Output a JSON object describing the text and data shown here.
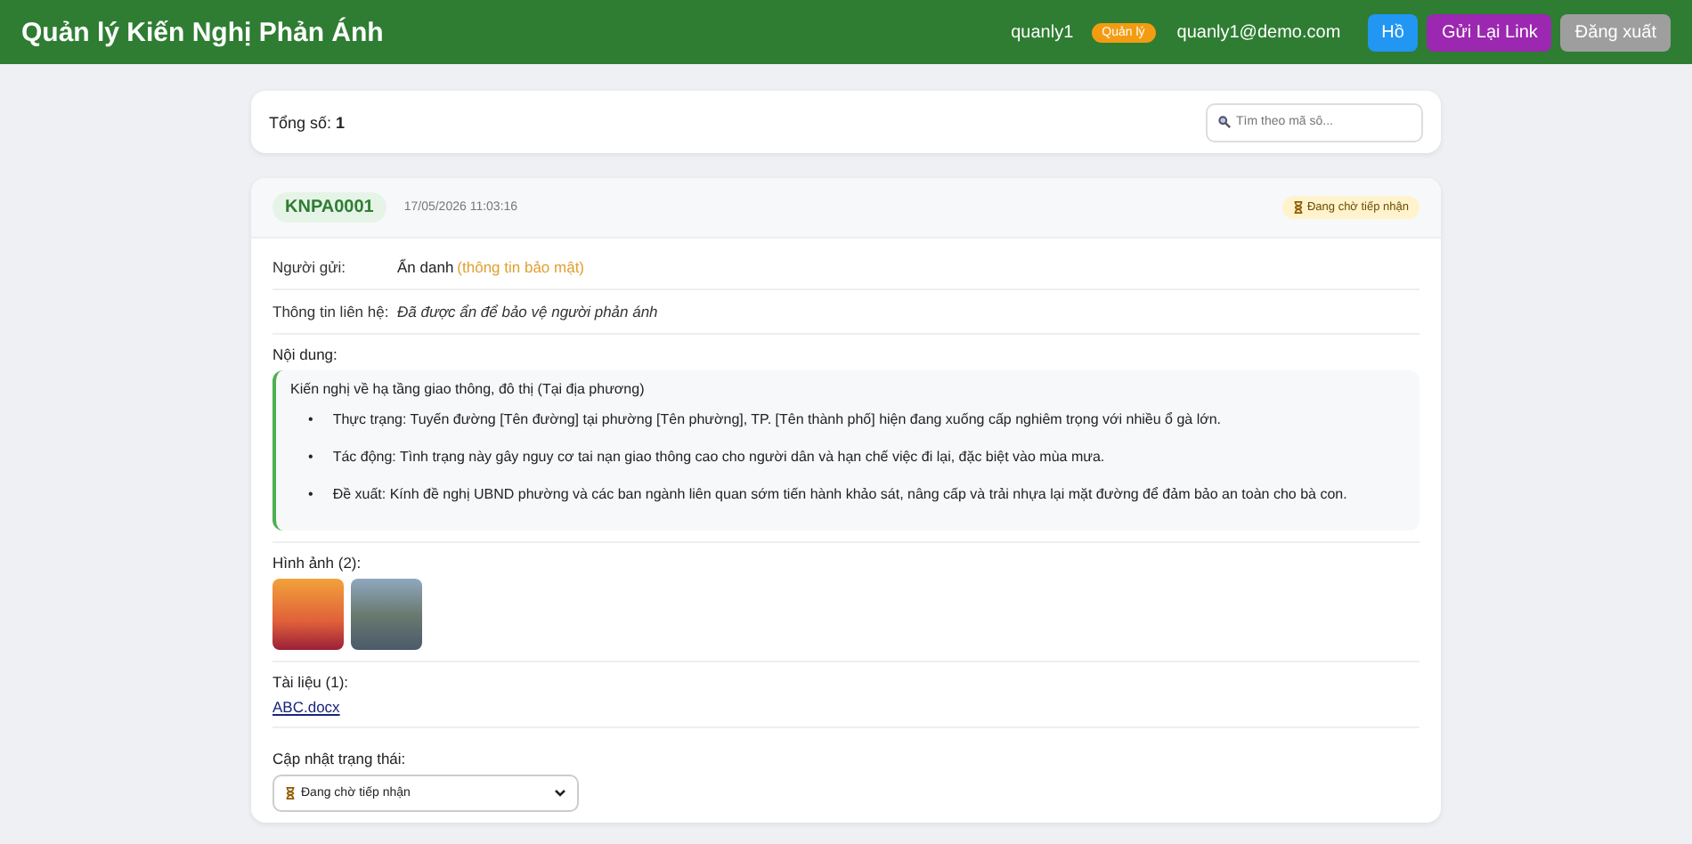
{
  "header": {
    "title": "Quản lý Kiến Nghị Phản Ánh",
    "username": "quanly1",
    "role_badge": "Quản lý",
    "email": "quanly1@demo.com",
    "buttons": [
      {
        "kind": "primary",
        "label": "Hồ"
      },
      {
        "kind": "accent",
        "label": "Gửi Lại Link"
      },
      {
        "kind": "muted",
        "label": "Đăng xuất"
      }
    ]
  },
  "summary": {
    "label": "Tổng số:",
    "count": "1",
    "search": {
      "placeholder": "Tìm theo mã số..."
    }
  },
  "petition": {
    "code": "KNPA0001",
    "timestamp": "17/05/2026 11:03:16",
    "status": "Đang chờ tiếp nhận",
    "sender": {
      "label": "Người gửi:",
      "value": "Ẩn danh",
      "note": "(thông tin bảo mật)"
    },
    "contact": {
      "label": "Thông tin liên hệ:",
      "value": "Đã được ẩn để bảo vệ người phản ánh"
    },
    "content": {
      "label": "Nội dung:",
      "title": "Kiến nghị về hạ tầng giao thông, đô thị (Tại địa phương)",
      "bullets": [
        {
          "marker": "•",
          "text": "Thực trạng: Tuyến đường [Tên đường] tại phường [Tên phường], TP. [Tên thành phố] hiện đang xuống cấp nghiêm trọng với nhiều ổ gà lớn."
        },
        {
          "marker": "•",
          "text": "Tác động: Tình trạng này gây nguy cơ tai nạn giao thông cao cho người dân và hạn chế việc đi lại, đặc biệt vào mùa mưa."
        },
        {
          "marker": "•",
          "text": "Đề xuất: Kính đề nghị UBND phường và các ban ngành liên quan sớm tiến hành khảo sát, nâng cấp và trải nhựa lại mặt đường để đảm bảo an toàn cho bà con."
        }
      ]
    },
    "images": {
      "label": "Hình ảnh (2):",
      "items": [
        {
          "kind": "sunset"
        },
        {
          "kind": "city"
        }
      ]
    },
    "documents": {
      "label": "Tài liệu (1):",
      "files": [
        "ABC.docx"
      ]
    },
    "status_update": {
      "label": "Cập nhật trạng thái:",
      "value": "Đang chờ tiếp nhận"
    }
  }
}
